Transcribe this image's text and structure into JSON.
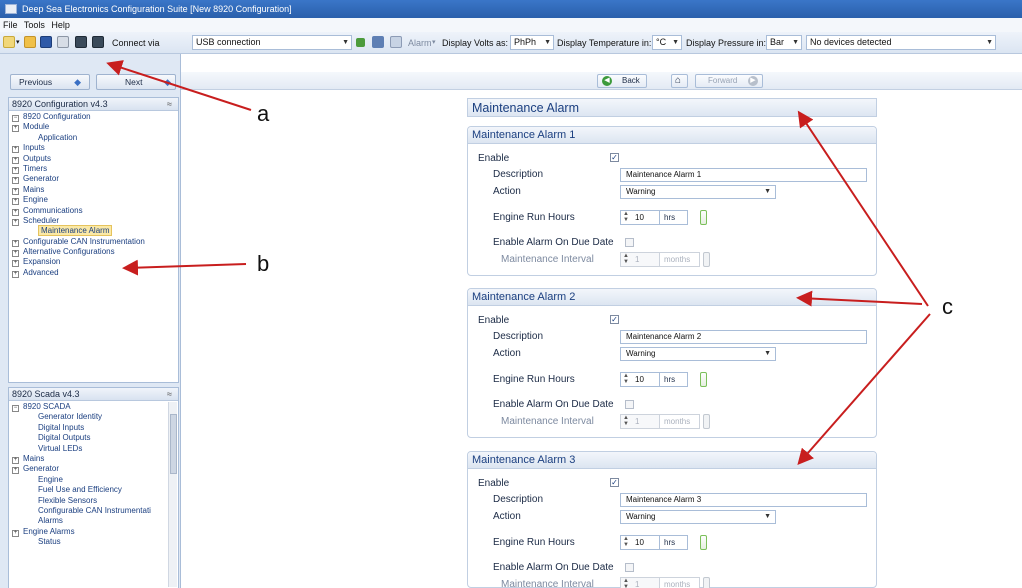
{
  "window": {
    "title": "Deep Sea Electronics Configuration Suite [New 8920 Configuration]"
  },
  "menu": [
    "File",
    "Tools",
    "Help"
  ],
  "toolbar": {
    "connect_via_label": "Connect via",
    "connect_via_value": "USB connection",
    "alarm_label": "Alarm",
    "volts_label": "Display Volts as:",
    "volts_value": "PhPh",
    "temp_label": "Display Temperature in:",
    "temp_value": "°C",
    "pressure_label": "Display Pressure in:",
    "pressure_value": "Bar",
    "device_status": "No devices detected"
  },
  "nav": {
    "previous": "Previous",
    "next": "Next",
    "back": "Back",
    "forward": "Forward"
  },
  "config_tree": {
    "header": "8920 Configuration v4.3",
    "items": [
      {
        "label": "8920 Configuration",
        "level": 0,
        "expander": "−"
      },
      {
        "label": "Module",
        "level": 1,
        "expander": "+"
      },
      {
        "label": "Application",
        "level": 2,
        "expander": ""
      },
      {
        "label": "Inputs",
        "level": 1,
        "expander": "+"
      },
      {
        "label": "Outputs",
        "level": 1,
        "expander": "+"
      },
      {
        "label": "Timers",
        "level": 1,
        "expander": "+"
      },
      {
        "label": "Generator",
        "level": 1,
        "expander": "+"
      },
      {
        "label": "Mains",
        "level": 1,
        "expander": "+"
      },
      {
        "label": "Engine",
        "level": 1,
        "expander": "+"
      },
      {
        "label": "Communications",
        "level": 1,
        "expander": "+"
      },
      {
        "label": "Scheduler",
        "level": 1,
        "expander": "+"
      },
      {
        "label": "Maintenance Alarm",
        "level": 2,
        "expander": "",
        "selected": true
      },
      {
        "label": "Configurable CAN Instrumentation",
        "level": 1,
        "expander": "+"
      },
      {
        "label": "Alternative Configurations",
        "level": 1,
        "expander": "+"
      },
      {
        "label": "Expansion",
        "level": 1,
        "expander": "+"
      },
      {
        "label": "Advanced",
        "level": 1,
        "expander": "+"
      }
    ]
  },
  "scada_tree": {
    "header": "8920 Scada v4.3",
    "items": [
      {
        "label": "8920 SCADA",
        "level": 0,
        "expander": "−"
      },
      {
        "label": "Generator Identity",
        "level": 2,
        "expander": ""
      },
      {
        "label": "Digital Inputs",
        "level": 2,
        "expander": ""
      },
      {
        "label": "Digital Outputs",
        "level": 2,
        "expander": ""
      },
      {
        "label": "Virtual LEDs",
        "level": 2,
        "expander": ""
      },
      {
        "label": "Mains",
        "level": 1,
        "expander": "+"
      },
      {
        "label": "Generator",
        "level": 1,
        "expander": "+"
      },
      {
        "label": "Engine",
        "level": 2,
        "expander": ""
      },
      {
        "label": "Fuel Use and Efficiency",
        "level": 2,
        "expander": ""
      },
      {
        "label": "Flexible Sensors",
        "level": 2,
        "expander": ""
      },
      {
        "label": "Configurable CAN Instrumentati",
        "level": 2,
        "expander": ""
      },
      {
        "label": "Alarms",
        "level": 2,
        "expander": ""
      },
      {
        "label": "Engine Alarms",
        "level": 1,
        "expander": "+"
      },
      {
        "label": "Status",
        "level": 2,
        "expander": ""
      }
    ]
  },
  "page": {
    "title": "Maintenance Alarm"
  },
  "labels": {
    "enable": "Enable",
    "description": "Description",
    "action": "Action",
    "run_hours": "Engine Run Hours",
    "due_date": "Enable Alarm On Due Date",
    "interval": "Maintenance Interval",
    "hrs": "hrs",
    "months": "months"
  },
  "alarms": [
    {
      "title": "Maintenance Alarm 1",
      "enabled": true,
      "description": "Maintenance Alarm 1",
      "action": "Warning",
      "run_hours": "10",
      "due_date_enabled": false,
      "interval": "1"
    },
    {
      "title": "Maintenance Alarm 2",
      "enabled": true,
      "description": "Maintenance Alarm 2",
      "action": "Warning",
      "run_hours": "10",
      "due_date_enabled": false,
      "interval": "1"
    },
    {
      "title": "Maintenance Alarm 3",
      "enabled": true,
      "description": "Maintenance Alarm 3",
      "action": "Warning",
      "run_hours": "10",
      "due_date_enabled": false,
      "interval": "1"
    }
  ],
  "annotations": {
    "a": "a",
    "b": "b",
    "c": "c"
  },
  "colors": {
    "titlebar": "#2a5fab",
    "annotation_arrow": "#c81e1e",
    "selected_highlight": "#fbe9a6"
  }
}
